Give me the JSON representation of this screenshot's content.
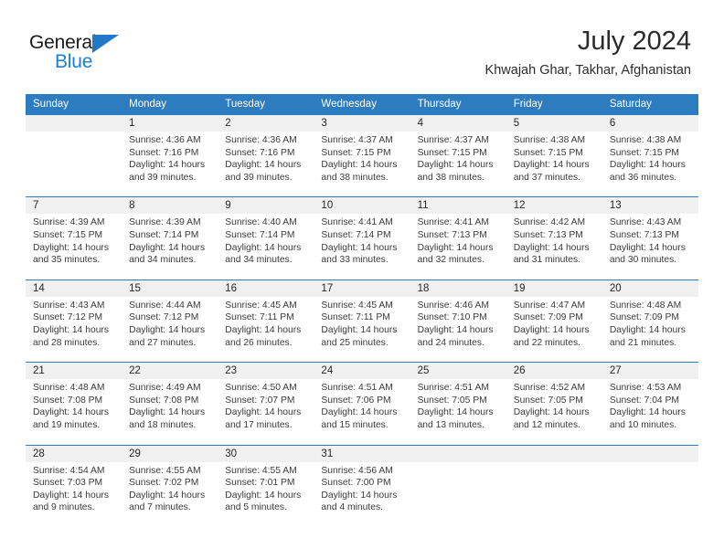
{
  "brand": {
    "name_top": "General",
    "name_bottom": "Blue",
    "triangle_color": "#2277c8",
    "blue_text_color": "#1a7fd4"
  },
  "header": {
    "title": "July 2024",
    "subtitle": "Khwajah Ghar, Takhar, Afghanistan"
  },
  "theme": {
    "header_bar": "#2e7cc0",
    "header_text": "#ffffff",
    "daynum_band": "#f0f0f0",
    "row_rule": "#2e7cc0",
    "body_text": "#3a3a3a"
  },
  "weekday_headers": [
    "Sunday",
    "Monday",
    "Tuesday",
    "Wednesday",
    "Thursday",
    "Friday",
    "Saturday"
  ],
  "weeks": [
    [
      {
        "day": "",
        "sunrise": "",
        "sunset": "",
        "daylight_line1": "",
        "daylight_line2": ""
      },
      {
        "day": "1",
        "sunrise": "Sunrise: 4:36 AM",
        "sunset": "Sunset: 7:16 PM",
        "daylight_line1": "Daylight: 14 hours",
        "daylight_line2": "and 39 minutes."
      },
      {
        "day": "2",
        "sunrise": "Sunrise: 4:36 AM",
        "sunset": "Sunset: 7:16 PM",
        "daylight_line1": "Daylight: 14 hours",
        "daylight_line2": "and 39 minutes."
      },
      {
        "day": "3",
        "sunrise": "Sunrise: 4:37 AM",
        "sunset": "Sunset: 7:15 PM",
        "daylight_line1": "Daylight: 14 hours",
        "daylight_line2": "and 38 minutes."
      },
      {
        "day": "4",
        "sunrise": "Sunrise: 4:37 AM",
        "sunset": "Sunset: 7:15 PM",
        "daylight_line1": "Daylight: 14 hours",
        "daylight_line2": "and 38 minutes."
      },
      {
        "day": "5",
        "sunrise": "Sunrise: 4:38 AM",
        "sunset": "Sunset: 7:15 PM",
        "daylight_line1": "Daylight: 14 hours",
        "daylight_line2": "and 37 minutes."
      },
      {
        "day": "6",
        "sunrise": "Sunrise: 4:38 AM",
        "sunset": "Sunset: 7:15 PM",
        "daylight_line1": "Daylight: 14 hours",
        "daylight_line2": "and 36 minutes."
      }
    ],
    [
      {
        "day": "7",
        "sunrise": "Sunrise: 4:39 AM",
        "sunset": "Sunset: 7:15 PM",
        "daylight_line1": "Daylight: 14 hours",
        "daylight_line2": "and 35 minutes."
      },
      {
        "day": "8",
        "sunrise": "Sunrise: 4:39 AM",
        "sunset": "Sunset: 7:14 PM",
        "daylight_line1": "Daylight: 14 hours",
        "daylight_line2": "and 34 minutes."
      },
      {
        "day": "9",
        "sunrise": "Sunrise: 4:40 AM",
        "sunset": "Sunset: 7:14 PM",
        "daylight_line1": "Daylight: 14 hours",
        "daylight_line2": "and 34 minutes."
      },
      {
        "day": "10",
        "sunrise": "Sunrise: 4:41 AM",
        "sunset": "Sunset: 7:14 PM",
        "daylight_line1": "Daylight: 14 hours",
        "daylight_line2": "and 33 minutes."
      },
      {
        "day": "11",
        "sunrise": "Sunrise: 4:41 AM",
        "sunset": "Sunset: 7:13 PM",
        "daylight_line1": "Daylight: 14 hours",
        "daylight_line2": "and 32 minutes."
      },
      {
        "day": "12",
        "sunrise": "Sunrise: 4:42 AM",
        "sunset": "Sunset: 7:13 PM",
        "daylight_line1": "Daylight: 14 hours",
        "daylight_line2": "and 31 minutes."
      },
      {
        "day": "13",
        "sunrise": "Sunrise: 4:43 AM",
        "sunset": "Sunset: 7:13 PM",
        "daylight_line1": "Daylight: 14 hours",
        "daylight_line2": "and 30 minutes."
      }
    ],
    [
      {
        "day": "14",
        "sunrise": "Sunrise: 4:43 AM",
        "sunset": "Sunset: 7:12 PM",
        "daylight_line1": "Daylight: 14 hours",
        "daylight_line2": "and 28 minutes."
      },
      {
        "day": "15",
        "sunrise": "Sunrise: 4:44 AM",
        "sunset": "Sunset: 7:12 PM",
        "daylight_line1": "Daylight: 14 hours",
        "daylight_line2": "and 27 minutes."
      },
      {
        "day": "16",
        "sunrise": "Sunrise: 4:45 AM",
        "sunset": "Sunset: 7:11 PM",
        "daylight_line1": "Daylight: 14 hours",
        "daylight_line2": "and 26 minutes."
      },
      {
        "day": "17",
        "sunrise": "Sunrise: 4:45 AM",
        "sunset": "Sunset: 7:11 PM",
        "daylight_line1": "Daylight: 14 hours",
        "daylight_line2": "and 25 minutes."
      },
      {
        "day": "18",
        "sunrise": "Sunrise: 4:46 AM",
        "sunset": "Sunset: 7:10 PM",
        "daylight_line1": "Daylight: 14 hours",
        "daylight_line2": "and 24 minutes."
      },
      {
        "day": "19",
        "sunrise": "Sunrise: 4:47 AM",
        "sunset": "Sunset: 7:09 PM",
        "daylight_line1": "Daylight: 14 hours",
        "daylight_line2": "and 22 minutes."
      },
      {
        "day": "20",
        "sunrise": "Sunrise: 4:48 AM",
        "sunset": "Sunset: 7:09 PM",
        "daylight_line1": "Daylight: 14 hours",
        "daylight_line2": "and 21 minutes."
      }
    ],
    [
      {
        "day": "21",
        "sunrise": "Sunrise: 4:48 AM",
        "sunset": "Sunset: 7:08 PM",
        "daylight_line1": "Daylight: 14 hours",
        "daylight_line2": "and 19 minutes."
      },
      {
        "day": "22",
        "sunrise": "Sunrise: 4:49 AM",
        "sunset": "Sunset: 7:08 PM",
        "daylight_line1": "Daylight: 14 hours",
        "daylight_line2": "and 18 minutes."
      },
      {
        "day": "23",
        "sunrise": "Sunrise: 4:50 AM",
        "sunset": "Sunset: 7:07 PM",
        "daylight_line1": "Daylight: 14 hours",
        "daylight_line2": "and 17 minutes."
      },
      {
        "day": "24",
        "sunrise": "Sunrise: 4:51 AM",
        "sunset": "Sunset: 7:06 PM",
        "daylight_line1": "Daylight: 14 hours",
        "daylight_line2": "and 15 minutes."
      },
      {
        "day": "25",
        "sunrise": "Sunrise: 4:51 AM",
        "sunset": "Sunset: 7:05 PM",
        "daylight_line1": "Daylight: 14 hours",
        "daylight_line2": "and 13 minutes."
      },
      {
        "day": "26",
        "sunrise": "Sunrise: 4:52 AM",
        "sunset": "Sunset: 7:05 PM",
        "daylight_line1": "Daylight: 14 hours",
        "daylight_line2": "and 12 minutes."
      },
      {
        "day": "27",
        "sunrise": "Sunrise: 4:53 AM",
        "sunset": "Sunset: 7:04 PM",
        "daylight_line1": "Daylight: 14 hours",
        "daylight_line2": "and 10 minutes."
      }
    ],
    [
      {
        "day": "28",
        "sunrise": "Sunrise: 4:54 AM",
        "sunset": "Sunset: 7:03 PM",
        "daylight_line1": "Daylight: 14 hours",
        "daylight_line2": "and 9 minutes."
      },
      {
        "day": "29",
        "sunrise": "Sunrise: 4:55 AM",
        "sunset": "Sunset: 7:02 PM",
        "daylight_line1": "Daylight: 14 hours",
        "daylight_line2": "and 7 minutes."
      },
      {
        "day": "30",
        "sunrise": "Sunrise: 4:55 AM",
        "sunset": "Sunset: 7:01 PM",
        "daylight_line1": "Daylight: 14 hours",
        "daylight_line2": "and 5 minutes."
      },
      {
        "day": "31",
        "sunrise": "Sunrise: 4:56 AM",
        "sunset": "Sunset: 7:00 PM",
        "daylight_line1": "Daylight: 14 hours",
        "daylight_line2": "and 4 minutes."
      },
      {
        "day": "",
        "sunrise": "",
        "sunset": "",
        "daylight_line1": "",
        "daylight_line2": ""
      },
      {
        "day": "",
        "sunrise": "",
        "sunset": "",
        "daylight_line1": "",
        "daylight_line2": ""
      },
      {
        "day": "",
        "sunrise": "",
        "sunset": "",
        "daylight_line1": "",
        "daylight_line2": ""
      }
    ]
  ]
}
